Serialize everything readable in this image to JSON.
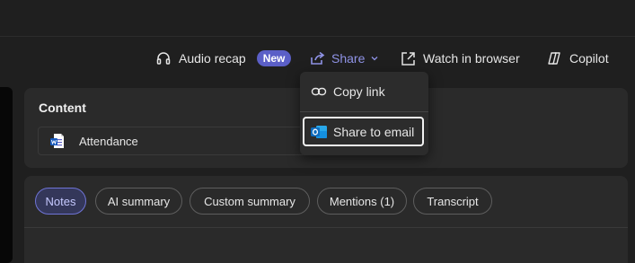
{
  "toolbar": {
    "audio_recap": {
      "label": "Audio recap",
      "badge": "New",
      "icon": "headphones-icon"
    },
    "share": {
      "label": "Share",
      "icon": "share-icon",
      "chevron": "chevron-down-icon"
    },
    "watch_in_browser": {
      "label": "Watch in browser",
      "icon": "open-external-icon"
    },
    "copilot": {
      "label": "Copilot",
      "icon": "copilot-icon"
    }
  },
  "share_menu": {
    "items": [
      {
        "label": "Copy link",
        "icon": "link-icon"
      },
      {
        "label": "Share to email",
        "icon": "outlook-icon"
      }
    ]
  },
  "content": {
    "title": "Content",
    "files": [
      {
        "name": "Attendance",
        "icon": "word-document-icon"
      }
    ]
  },
  "tabs": [
    {
      "label": "Notes",
      "active": true
    },
    {
      "label": "AI summary"
    },
    {
      "label": "Custom summary"
    },
    {
      "label": "Mentions (1)"
    },
    {
      "label": "Transcript"
    }
  ],
  "colors": {
    "background": "#1f1f1f",
    "card": "#2a2a2a",
    "accent": "#5b5fc7",
    "share_accent": "#8f93e6",
    "outlook_blue": "#0f6cbd"
  }
}
